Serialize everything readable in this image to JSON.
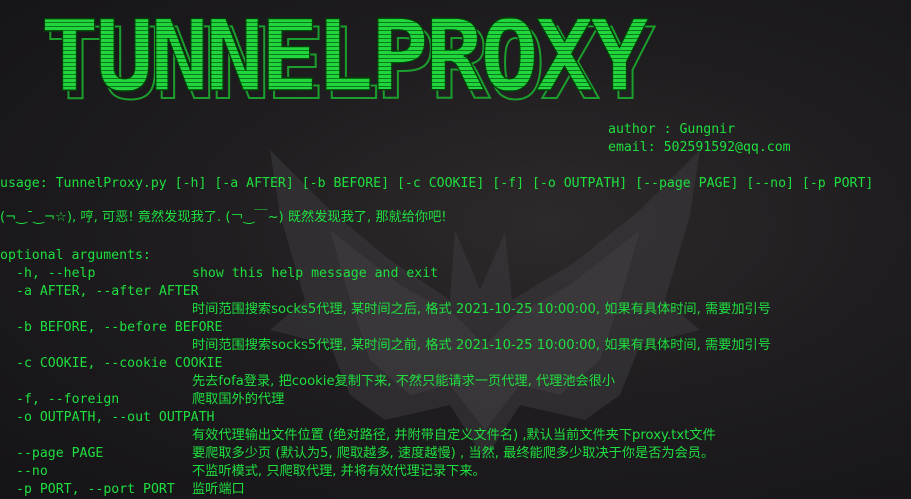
{
  "banner": {
    "title": "TUNNELPROXY"
  },
  "meta": {
    "author": "author : Gungnir",
    "email": "email: 502591592@qq.com"
  },
  "usage": "usage: TunnelProxy.py [-h] [-a AFTER] [-b BEFORE] [-c COOKIE] [-f] [-o OUTPATH] [--page PAGE] [--no] [-p PORT]",
  "taunt": "(¬‿¯‿¬☆), 哼, 可恶! 竟然发现我了. (￢‿￣~) 既然发现我了, 那就给你吧!",
  "optional_header": "optional arguments:",
  "options": [
    {
      "flag": "-h, --help",
      "desc": "show this help message and exit"
    },
    {
      "flag": "-a AFTER, --after AFTER",
      "desc": "时间范围搜索socks5代理, 某时间之后, 格式 2021-10-25 10:00:00, 如果有具体时间, 需要加引号"
    },
    {
      "flag": "-b BEFORE, --before BEFORE",
      "desc": "时间范围搜索socks5代理, 某时间之前, 格式 2021-10-25 10:00:00, 如果有具体时间, 需要加引号"
    },
    {
      "flag": "-c COOKIE, --cookie COOKIE",
      "desc": "先去fofa登录, 把cookie复制下来, 不然只能请求一页代理, 代理池会很小"
    },
    {
      "flag": "-f, --foreign",
      "desc": "爬取国外的代理"
    },
    {
      "flag": "-o OUTPATH, --out OUTPATH",
      "desc": "有效代理输出文件位置 (绝对路径, 并附带自定义文件名) ,默认当前文件夹下proxy.txt文件"
    },
    {
      "flag": "--page PAGE",
      "desc": "要爬取多少页 (默认为5, 爬取越多, 速度越慢) , 当然, 最终能爬多少取决于你是否为会员。"
    },
    {
      "flag": "--no",
      "desc": "不监听模式, 只爬取代理, 并将有效代理记录下来。"
    },
    {
      "flag": "-p PORT, --port PORT",
      "desc": "监听端口"
    }
  ],
  "colors": {
    "text": "#1fdf3f",
    "banner_fill": "#22d63e",
    "background": "#1c1b1d"
  }
}
